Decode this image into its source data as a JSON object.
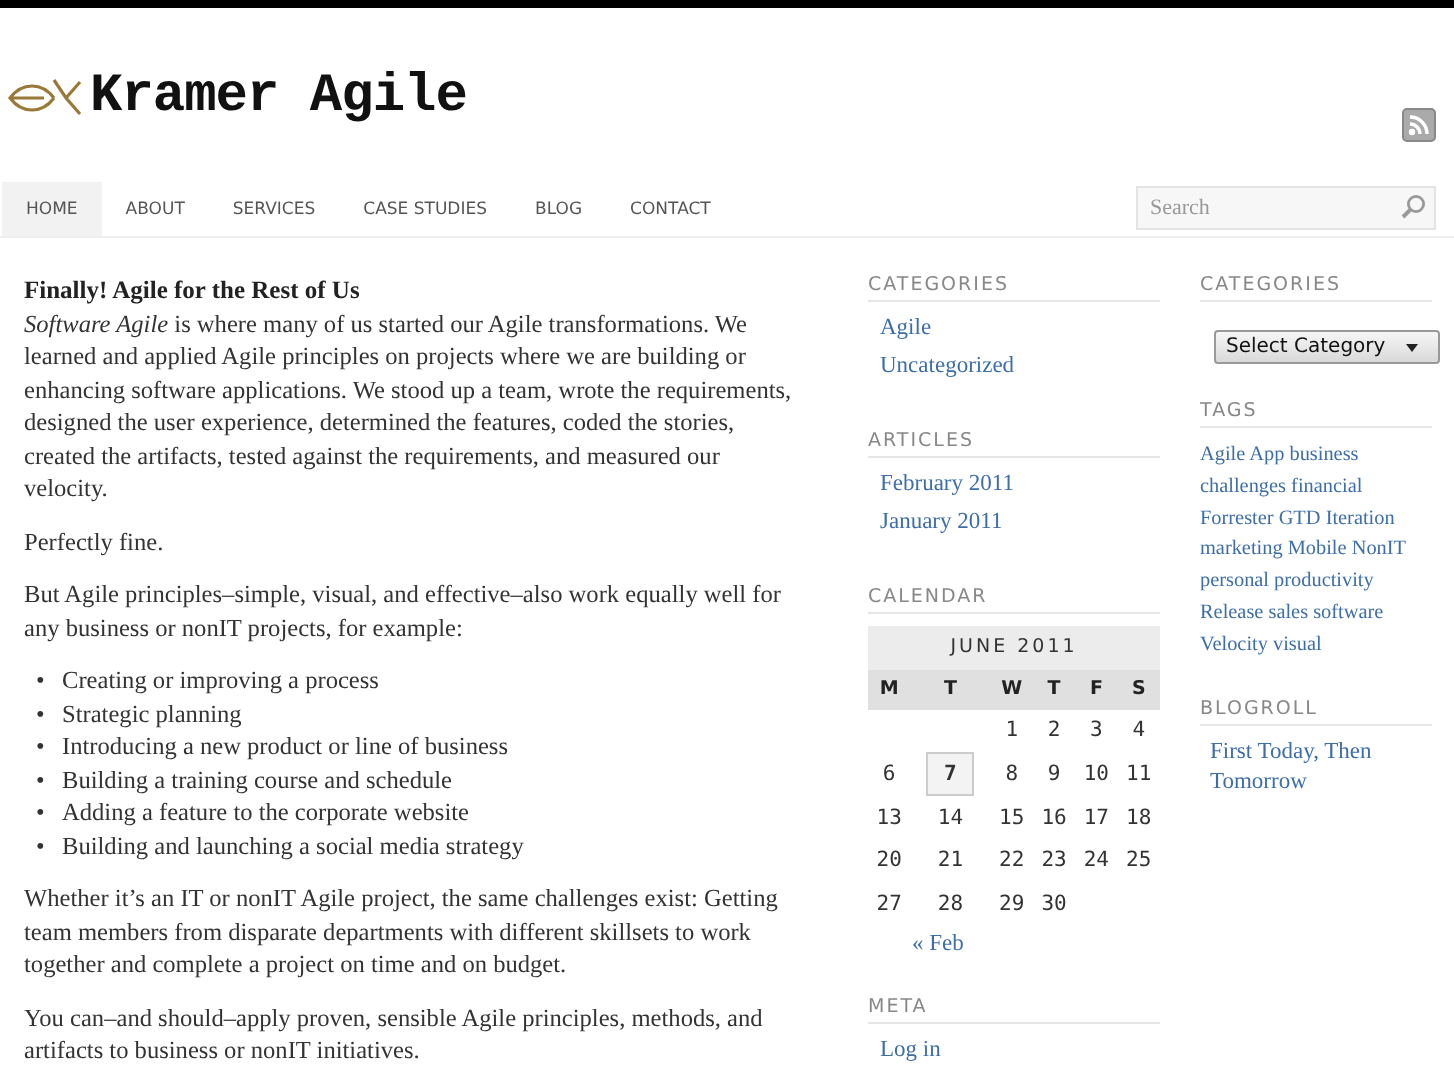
{
  "site": {
    "title": "Kramer Agile"
  },
  "nav": [
    {
      "label": "HOME",
      "selected": true
    },
    {
      "label": "ABOUT",
      "selected": false
    },
    {
      "label": "SERVICES",
      "selected": false
    },
    {
      "label": "CASE STUDIES",
      "selected": false
    },
    {
      "label": "BLOG",
      "selected": false
    },
    {
      "label": "CONTACT",
      "selected": false
    }
  ],
  "search": {
    "placeholder": "Search"
  },
  "article": {
    "title": "Finally! Agile for the Rest of Us",
    "blocks": [
      {
        "kind": "paragraph",
        "text": "*Software Agile* is where many of us started our Agile transformations. We  learned and applied Agile principles on projects where we are building or enhancing software applications.  We stood up a team, wrote the requirements, designed the user experience, determined the features, coded the stories, created the artifacts, tested against the requirements, and measured our velocity."
      },
      {
        "kind": "paragraph",
        "text": "Perfectly fine."
      },
      {
        "kind": "paragraph",
        "text": "But Agile principles–simple, visual, and effective–also work equally well for any business or nonIT projects, for example:"
      },
      {
        "kind": "list",
        "marker": "•",
        "items": [
          "Creating or improving a process",
          "Strategic planning",
          "Introducing a new product or line of business",
          "Building a training course and schedule",
          "Adding a feature to the corporate website",
          "Building and launching a social media strategy"
        ]
      },
      {
        "kind": "paragraph",
        "text": "Whether it’s an IT or nonIT Agile project, the same challenges exist: Getting team members from disparate departments with different skillsets to work together and complete a project on time and on budget."
      },
      {
        "kind": "paragraph",
        "text": "You can–and should–apply proven, sensible Agile principles, methods, and artifacts to business or nonIT initiatives."
      }
    ]
  },
  "sidebar_left": {
    "categories": {
      "title": "CATEGORIES",
      "links": [
        "Agile",
        "Uncategorized"
      ]
    },
    "articles": {
      "title": "ARTICLES",
      "links": [
        "February 2011",
        "January 2011"
      ]
    },
    "calendar": {
      "title": "CALENDAR",
      "caption": "JUNE 2011",
      "weekdays": [
        "M",
        "T",
        "W",
        "T",
        "F",
        "S"
      ],
      "weeks": [
        [
          {
            "kind": "empty"
          },
          {
            "kind": "empty"
          },
          {
            "kind": "day",
            "day": "1",
            "today": false
          },
          {
            "kind": "day",
            "day": "2",
            "today": false
          },
          {
            "kind": "day",
            "day": "3",
            "today": false
          },
          {
            "kind": "day",
            "day": "4",
            "today": false
          }
        ],
        [
          {
            "kind": "day",
            "day": "6",
            "today": false
          },
          {
            "kind": "day",
            "day": "7",
            "today": true
          },
          {
            "kind": "day",
            "day": "8",
            "today": false
          },
          {
            "kind": "day",
            "day": "9",
            "today": false
          },
          {
            "kind": "day",
            "day": "10",
            "today": false
          },
          {
            "kind": "day",
            "day": "11",
            "today": false
          }
        ],
        [
          {
            "kind": "day",
            "day": "13",
            "today": false
          },
          {
            "kind": "day",
            "day": "14",
            "today": false
          },
          {
            "kind": "day",
            "day": "15",
            "today": false
          },
          {
            "kind": "day",
            "day": "16",
            "today": false
          },
          {
            "kind": "day",
            "day": "17",
            "today": false
          },
          {
            "kind": "day",
            "day": "18",
            "today": false
          }
        ],
        [
          {
            "kind": "day",
            "day": "20",
            "today": false
          },
          {
            "kind": "day",
            "day": "21",
            "today": false
          },
          {
            "kind": "day",
            "day": "22",
            "today": false
          },
          {
            "kind": "day",
            "day": "23",
            "today": false
          },
          {
            "kind": "day",
            "day": "24",
            "today": false
          },
          {
            "kind": "day",
            "day": "25",
            "today": false
          }
        ],
        [
          {
            "kind": "day",
            "day": "27",
            "today": false
          },
          {
            "kind": "day",
            "day": "28",
            "today": false
          },
          {
            "kind": "day",
            "day": "29",
            "today": false
          },
          {
            "kind": "day",
            "day": "30",
            "today": false
          },
          {
            "kind": "empty"
          },
          {
            "kind": "empty"
          }
        ]
      ],
      "prev_link": "« Feb"
    },
    "meta": {
      "title": "META",
      "links": [
        "Log in"
      ]
    }
  },
  "sidebar_right": {
    "categories": {
      "title": "CATEGORIES",
      "select": "Select Category"
    },
    "tags": {
      "title": "TAGS",
      "items": [
        "Agile",
        "App",
        "business",
        "challenges",
        "financial",
        "Forrester",
        "GTD",
        "Iteration",
        "marketing",
        "Mobile",
        "NonIT",
        "personal productivity",
        "Release",
        "sales",
        "software",
        "Velocity",
        "visual"
      ]
    },
    "blogroll": {
      "title": "BLOGROLL",
      "links": [
        "First Today, Then Tomorrow"
      ]
    }
  }
}
